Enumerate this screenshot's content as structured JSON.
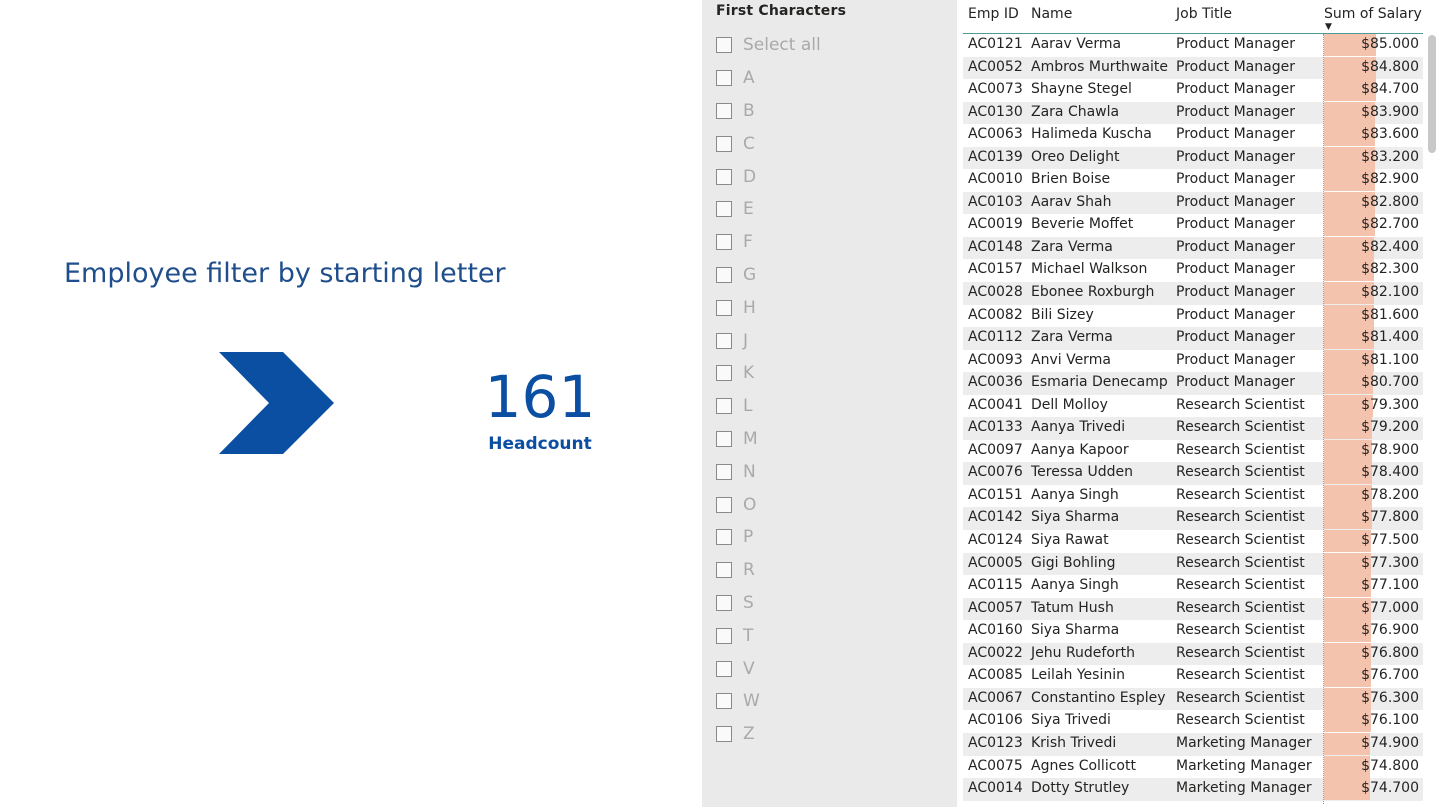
{
  "title": "Employee filter by starting letter",
  "kpi": {
    "value": "161",
    "label": "Headcount"
  },
  "colors": {
    "accent": "#0b4fa3",
    "databar": "#f4c3ae"
  },
  "slicer": {
    "header": "First Characters",
    "items": [
      {
        "label": "Select all"
      },
      {
        "label": "A"
      },
      {
        "label": "B"
      },
      {
        "label": "C"
      },
      {
        "label": "D"
      },
      {
        "label": "E"
      },
      {
        "label": "F"
      },
      {
        "label": "G"
      },
      {
        "label": "H"
      },
      {
        "label": "J"
      },
      {
        "label": "K"
      },
      {
        "label": "L"
      },
      {
        "label": "M"
      },
      {
        "label": "N"
      },
      {
        "label": "O"
      },
      {
        "label": "P"
      },
      {
        "label": "R"
      },
      {
        "label": "S"
      },
      {
        "label": "T"
      },
      {
        "label": "V"
      },
      {
        "label": "W"
      },
      {
        "label": "Z"
      }
    ]
  },
  "table": {
    "columns": [
      "Emp ID",
      "Name",
      "Job Title",
      "Sum of Salary"
    ],
    "max_salary": 85000,
    "rows": [
      {
        "id": "AC0121",
        "name": "Aarav Verma",
        "job": "Product Manager",
        "salary": "$85.000",
        "value": 85000
      },
      {
        "id": "AC0052",
        "name": "Ambros Murthwaite",
        "job": "Product Manager",
        "salary": "$84.800",
        "value": 84800
      },
      {
        "id": "AC0073",
        "name": "Shayne Stegel",
        "job": "Product Manager",
        "salary": "$84.700",
        "value": 84700
      },
      {
        "id": "AC0130",
        "name": "Zara Chawla",
        "job": "Product Manager",
        "salary": "$83.900",
        "value": 83900
      },
      {
        "id": "AC0063",
        "name": "Halimeda Kuscha",
        "job": "Product Manager",
        "salary": "$83.600",
        "value": 83600
      },
      {
        "id": "AC0139",
        "name": "Oreo Delight",
        "job": "Product Manager",
        "salary": "$83.200",
        "value": 83200
      },
      {
        "id": "AC0010",
        "name": "Brien Boise",
        "job": "Product Manager",
        "salary": "$82.900",
        "value": 82900
      },
      {
        "id": "AC0103",
        "name": "Aarav Shah",
        "job": "Product Manager",
        "salary": "$82.800",
        "value": 82800
      },
      {
        "id": "AC0019",
        "name": "Beverie Moffet",
        "job": "Product Manager",
        "salary": "$82.700",
        "value": 82700
      },
      {
        "id": "AC0148",
        "name": "Zara Verma",
        "job": "Product Manager",
        "salary": "$82.400",
        "value": 82400
      },
      {
        "id": "AC0157",
        "name": "Michael Walkson",
        "job": "Product Manager",
        "salary": "$82.300",
        "value": 82300
      },
      {
        "id": "AC0028",
        "name": "Ebonee Roxburgh",
        "job": "Product Manager",
        "salary": "$82.100",
        "value": 82100
      },
      {
        "id": "AC0082",
        "name": "Bili Sizey",
        "job": "Product Manager",
        "salary": "$81.600",
        "value": 81600
      },
      {
        "id": "AC0112",
        "name": "Zara Verma",
        "job": "Product Manager",
        "salary": "$81.400",
        "value": 81400
      },
      {
        "id": "AC0093",
        "name": "Anvi Verma",
        "job": "Product Manager",
        "salary": "$81.100",
        "value": 81100
      },
      {
        "id": "AC0036",
        "name": "Esmaria Denecamp",
        "job": "Product Manager",
        "salary": "$80.700",
        "value": 80700
      },
      {
        "id": "AC0041",
        "name": "Dell Molloy",
        "job": "Research Scientist",
        "salary": "$79.300",
        "value": 79300
      },
      {
        "id": "AC0133",
        "name": "Aanya Trivedi",
        "job": "Research Scientist",
        "salary": "$79.200",
        "value": 79200
      },
      {
        "id": "AC0097",
        "name": "Aanya Kapoor",
        "job": "Research Scientist",
        "salary": "$78.900",
        "value": 78900
      },
      {
        "id": "AC0076",
        "name": "Teressa Udden",
        "job": "Research Scientist",
        "salary": "$78.400",
        "value": 78400
      },
      {
        "id": "AC0151",
        "name": "Aanya Singh",
        "job": "Research Scientist",
        "salary": "$78.200",
        "value": 78200
      },
      {
        "id": "AC0142",
        "name": "Siya Sharma",
        "job": "Research Scientist",
        "salary": "$77.800",
        "value": 77800
      },
      {
        "id": "AC0124",
        "name": "Siya Rawat",
        "job": "Research Scientist",
        "salary": "$77.500",
        "value": 77500
      },
      {
        "id": "AC0005",
        "name": "Gigi Bohling",
        "job": "Research Scientist",
        "salary": "$77.300",
        "value": 77300
      },
      {
        "id": "AC0115",
        "name": "Aanya Singh",
        "job": "Research Scientist",
        "salary": "$77.100",
        "value": 77100
      },
      {
        "id": "AC0057",
        "name": "Tatum Hush",
        "job": "Research Scientist",
        "salary": "$77.000",
        "value": 77000
      },
      {
        "id": "AC0160",
        "name": "Siya Sharma",
        "job": "Research Scientist",
        "salary": "$76.900",
        "value": 76900
      },
      {
        "id": "AC0022",
        "name": "Jehu Rudeforth",
        "job": "Research Scientist",
        "salary": "$76.800",
        "value": 76800
      },
      {
        "id": "AC0085",
        "name": "Leilah Yesinin",
        "job": "Research Scientist",
        "salary": "$76.700",
        "value": 76700
      },
      {
        "id": "AC0067",
        "name": "Constantino Espley",
        "job": "Research Scientist",
        "salary": "$76.300",
        "value": 76300
      },
      {
        "id": "AC0106",
        "name": "Siya Trivedi",
        "job": "Research Scientist",
        "salary": "$76.100",
        "value": 76100
      },
      {
        "id": "AC0123",
        "name": "Krish Trivedi",
        "job": "Marketing Manager",
        "salary": "$74.900",
        "value": 74900
      },
      {
        "id": "AC0075",
        "name": "Agnes Collicott",
        "job": "Marketing Manager",
        "salary": "$74.800",
        "value": 74800
      },
      {
        "id": "AC0014",
        "name": "Dotty Strutley",
        "job": "Marketing Manager",
        "salary": "$74.700",
        "value": 74700
      }
    ]
  }
}
